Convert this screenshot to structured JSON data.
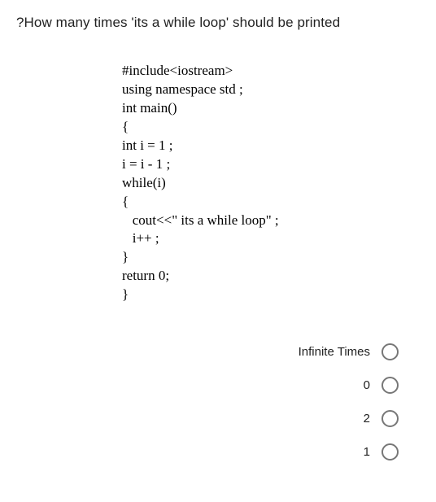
{
  "question": "?How many times 'its a while loop' should be printed",
  "code": "#include<iostream>\nusing namespace std ;\nint main()\n{\nint i = 1 ;\ni = i - 1 ;\nwhile(i)\n{\n   cout<<\" its a while loop\" ;\n   i++ ;\n}\nreturn 0;\n}",
  "options": [
    {
      "label": "Infinite Times"
    },
    {
      "label": "0"
    },
    {
      "label": "2"
    },
    {
      "label": "1"
    }
  ]
}
